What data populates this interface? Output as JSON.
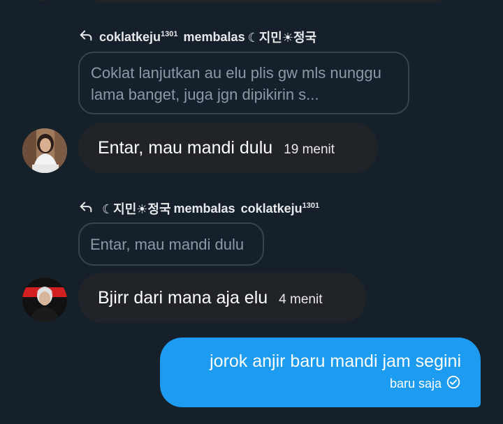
{
  "conversation": {
    "reply1": {
      "sender": "coklatkeju",
      "sender_sup": "1301",
      "action": "membalas",
      "target": "☾지민☀︎정국",
      "quote": "Coklat lanjutkan au elu plis gw mls nunggu lama banget, juga jgn dipikirin s..."
    },
    "message1": {
      "text": "Entar, mau mandi dulu",
      "time": "19 menit"
    },
    "reply2": {
      "sender": "☾지민☀︎정국",
      "action": "membalas",
      "target": "coklatkeju",
      "target_sup": "1301",
      "quote": "Entar, mau mandi dulu"
    },
    "message2": {
      "text": "Bjirr dari mana aja elu",
      "time": "4 menit"
    },
    "own_message": {
      "text": "jorok anjir baru mandi jam segini",
      "time": "baru saja"
    }
  },
  "icons": {
    "reply": "reply-arrow-icon",
    "sent": "check-circle-icon"
  },
  "colors": {
    "background": "#15202b",
    "bubble": "#202327",
    "own_bubble": "#1d9bf0",
    "quote_border": "#38444d",
    "muted_text": "#8b98a5"
  }
}
